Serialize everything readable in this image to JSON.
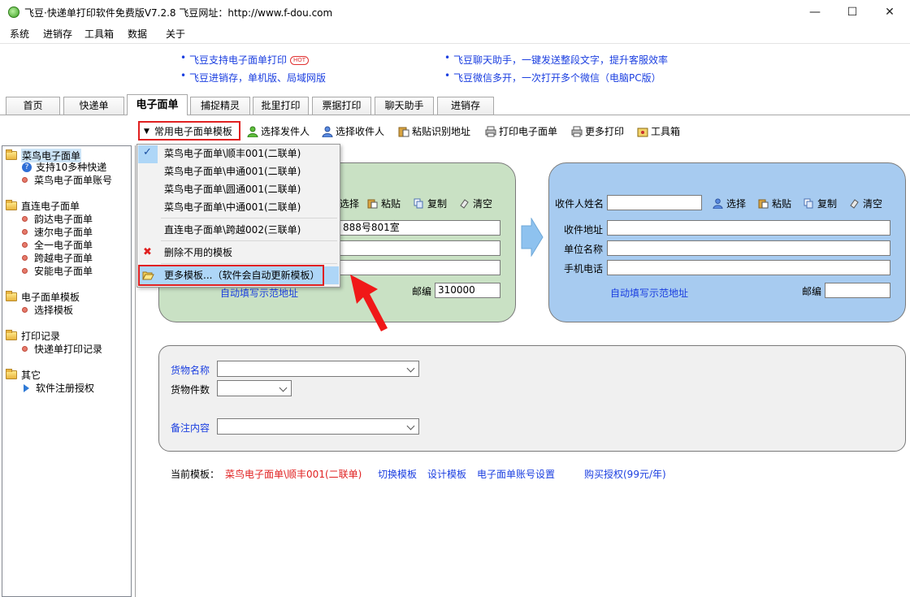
{
  "window": {
    "title": "飞豆·快递单打印软件免费版V7.2.8  飞豆网址：http://www.f-dou.com",
    "minimize": "—",
    "maximize": "☐",
    "close": "✕"
  },
  "menu": [
    "系统",
    "进销存",
    "工具箱",
    "数据",
    "关于"
  ],
  "promos": {
    "left": [
      "飞豆支持电子面单打印",
      "飞豆进销存，单机版、局域网版"
    ],
    "hot": "HOT",
    "right": [
      "飞豆聊天助手，一键发送整段文字，提升客服效率",
      "飞豆微信多开，一次打开多个微信（电脑PC版）"
    ]
  },
  "tabs": [
    "首页",
    "快递单",
    "电子面单",
    "捕捉精灵",
    "批里打印",
    "票据打印",
    "聊天助手",
    "进销存"
  ],
  "toolbar": {
    "template": "常用电子面单模板",
    "select_sender": "选择发件人",
    "select_receiver": "选择收件人",
    "paste_address": "粘贴识别地址",
    "print": "打印电子面单",
    "more_print": "更多打印",
    "tools": "工具箱"
  },
  "tree": [
    {
      "label": "菜鸟电子面单",
      "children": [
        "支持10多种快递",
        "菜鸟电子面单账号"
      ]
    },
    {
      "label": "直连电子面单",
      "children": [
        "韵达电子面单",
        "速尔电子面单",
        "全一电子面单",
        "跨越电子面单",
        "安能电子面单"
      ]
    },
    {
      "label": "电子面单模板",
      "children": [
        "选择模板"
      ]
    },
    {
      "label": "打印记录",
      "children": [
        "快递单打印记录"
      ]
    },
    {
      "label": "其它",
      "children": [
        "软件注册授权"
      ]
    }
  ],
  "dropdown": {
    "items": [
      "菜鸟电子面单\\顺丰001(二联单)",
      "菜鸟电子面单\\申通001(二联单)",
      "菜鸟电子面单\\圆通001(二联单)",
      "菜鸟电子面单\\中通001(二联单)"
    ],
    "direct": "直连电子面单\\跨越002(三联单)",
    "delete": "删除不用的模板",
    "more": "更多模板...（软件会自动更新模板）"
  },
  "sender": {
    "select": "选择",
    "paste": "粘贴",
    "copy": "复制",
    "clear": "清空",
    "address_value": "888号801室",
    "autofill": "自动填写示范地址",
    "zip_label": "邮编",
    "zip_value": "310000"
  },
  "receiver": {
    "name_label": "收件人姓名",
    "select": "选择",
    "paste": "粘贴",
    "copy": "复制",
    "clear": "清空",
    "address_label": "收件地址",
    "company_label": "单位名称",
    "phone_label": "手机电话",
    "autofill": "自动填写示范地址",
    "zip_label": "邮编"
  },
  "goods": {
    "name_label": "货物名称",
    "count_label": "货物件数",
    "remark_label": "备注内容"
  },
  "footer": {
    "current_label": "当前模板：",
    "current_value": "菜鸟电子面单\\顺丰001(二联单)",
    "switch": "切换模板",
    "design": "设计模板",
    "account": "电子面单账号设置",
    "buy": "购买授权(99元/年)"
  },
  "colors": {
    "sender_bg": "#c9e1c4",
    "receiver_bg": "#a7cbf0",
    "link": "#1a3ee0",
    "highlight_red": "#e02020",
    "menu_highlight": "#aed6f7"
  }
}
